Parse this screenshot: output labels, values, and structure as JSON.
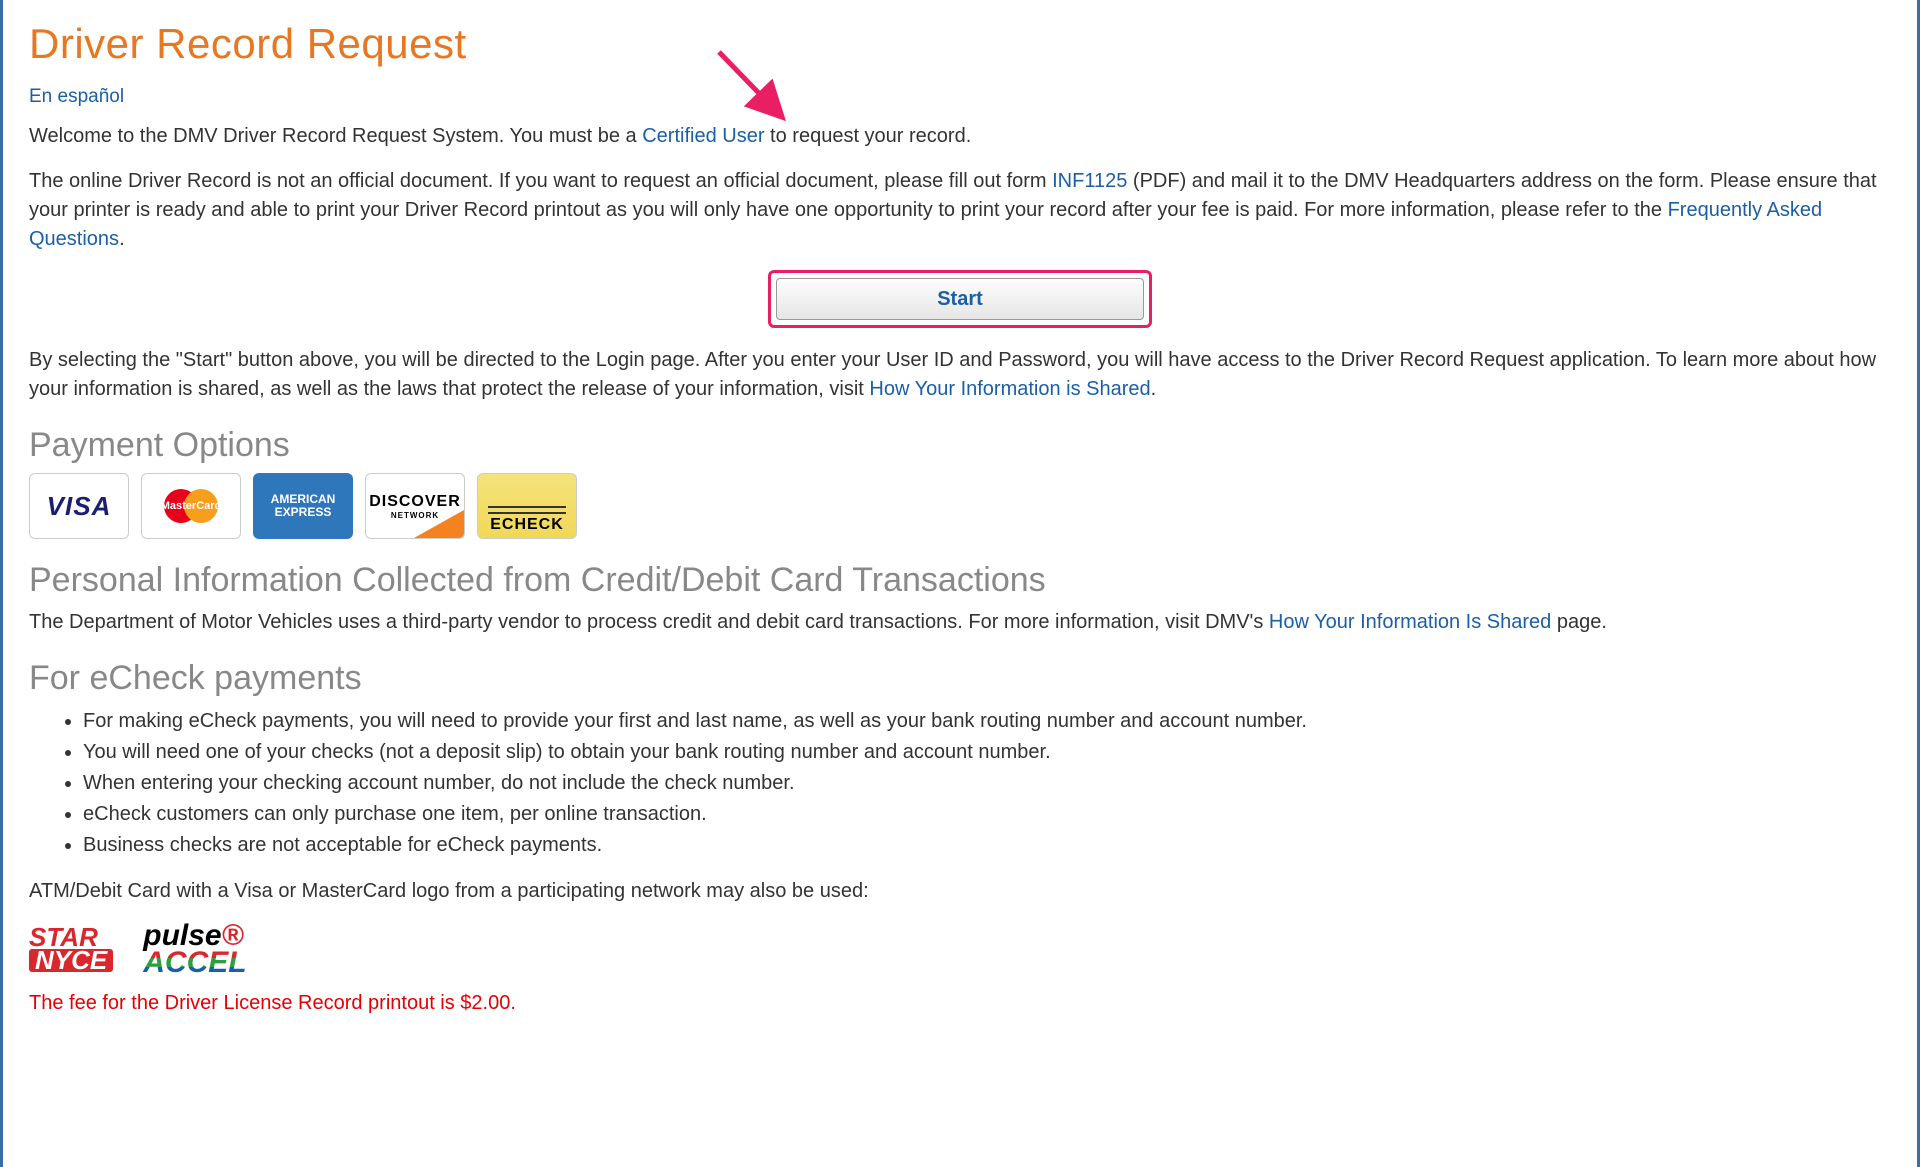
{
  "title": "Driver Record Request",
  "lang_link": "En español",
  "welcome": {
    "pre": "Welcome to the DMV Driver Record Request System. You must be a ",
    "link": "Certified User",
    "post": " to request your record."
  },
  "disclaimer": {
    "pre": "The online Driver Record is not an official document. If you want to request an official document, please fill out form ",
    "form_link": "INF1125",
    "mid": " (PDF) and mail it to the DMV Headquarters address on the form. Please ensure that your printer is ready and able to print your Driver Record printout as you will only have one opportunity to print your record after your fee is paid. For more information, please refer to the ",
    "faq_link": "Frequently Asked Questions",
    "post": "."
  },
  "start_button": "Start",
  "after_start": {
    "pre": "By selecting the \"Start\" button above, you will be directed to the Login page. After you enter your User ID and Password, you will have access to the Driver Record Request application. To learn more about how your information is shared, as well as the laws that protect the release of your information, visit ",
    "link": "How Your Information is Shared",
    "post": "."
  },
  "payment_heading": "Payment Options",
  "cards": {
    "visa": "VISA",
    "mastercard": "MasterCard",
    "amex": "AMERICAN EXPRESS",
    "discover": "DISCOVER",
    "discover_sub": "NETWORK",
    "echeck": "ECHECK"
  },
  "personal_info_heading": "Personal Information Collected from Credit/Debit Card Transactions",
  "personal_info": {
    "pre": "The Department of Motor Vehicles uses a third-party vendor to process credit and debit card transactions. For more information, visit DMV's ",
    "link": "How Your Information Is Shared",
    "post": " page."
  },
  "echeck_heading": "For eCheck payments",
  "echeck_bullets": [
    "For making eCheck payments, you will need to provide your first and last name, as well as your bank routing number and account number.",
    "You will need one of your checks (not a deposit slip) to obtain your bank routing number and account number.",
    "When entering your checking account number, do not include the check number.",
    "eCheck customers can only purchase one item, per online transaction.",
    "Business checks are not acceptable for eCheck payments."
  ],
  "atm_line": "ATM/Debit Card with a Visa or MasterCard logo from a participating network may also be used:",
  "networks": {
    "star": "STAR",
    "nyce": "NYCE",
    "pulse": "pulse",
    "accel": "ACCEL"
  },
  "fee_line": "The fee for the Driver License Record printout is $2.00."
}
